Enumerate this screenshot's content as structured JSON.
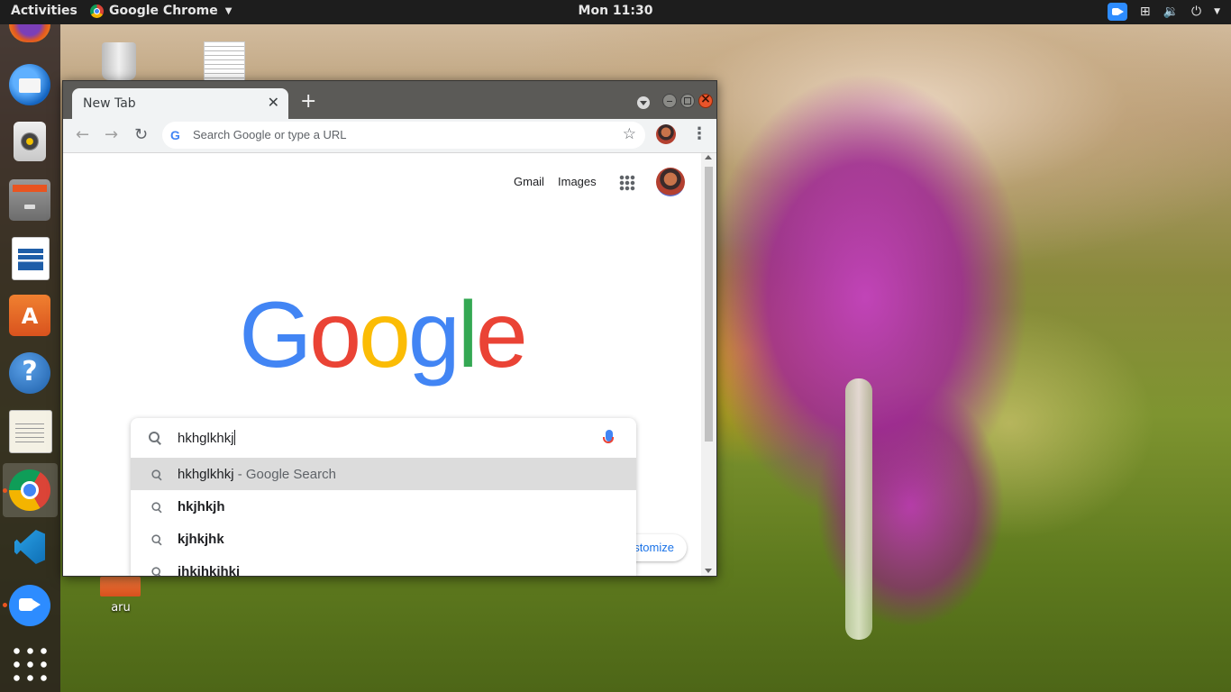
{
  "topbar": {
    "activities": "Activities",
    "app_name": "Google Chrome",
    "clock": "Mon 11:30"
  },
  "dock": {
    "items": [
      "firefox",
      "thunderbird",
      "rhythmbox",
      "files",
      "libreoffice-writer",
      "ubuntu-software",
      "help",
      "text-editor",
      "google-chrome",
      "vscode",
      "zoom",
      "show-applications"
    ],
    "active": "google-chrome"
  },
  "desktop": {
    "folder_label": "aru"
  },
  "browser": {
    "tab_title": "New Tab",
    "omnibox_placeholder": "Search Google or type a URL",
    "header_links": [
      "Gmail",
      "Images"
    ],
    "logo_letters": [
      {
        "ch": "G",
        "color": "#4285F4"
      },
      {
        "ch": "o",
        "color": "#EA4335"
      },
      {
        "ch": "o",
        "color": "#FBBC05"
      },
      {
        "ch": "g",
        "color": "#4285F4"
      },
      {
        "ch": "l",
        "color": "#34A853"
      },
      {
        "ch": "e",
        "color": "#EA4335"
      }
    ],
    "search_value": "hkhglkhkj",
    "suggestions": [
      {
        "text": "hkhglkhkj",
        "suffix": " - Google Search",
        "bold": false
      },
      {
        "text": "hkjhkjh",
        "suffix": "",
        "bold": true
      },
      {
        "text": "kjhkjhk",
        "suffix": "",
        "bold": true
      },
      {
        "text": "jhkjhkjhkj",
        "suffix": "",
        "bold": true
      }
    ],
    "customize_label": "Customize"
  },
  "colors": {
    "topbar_bg": "#1d1d1d",
    "dock_accent": "#e95420",
    "link_blue": "#1a73e8"
  }
}
